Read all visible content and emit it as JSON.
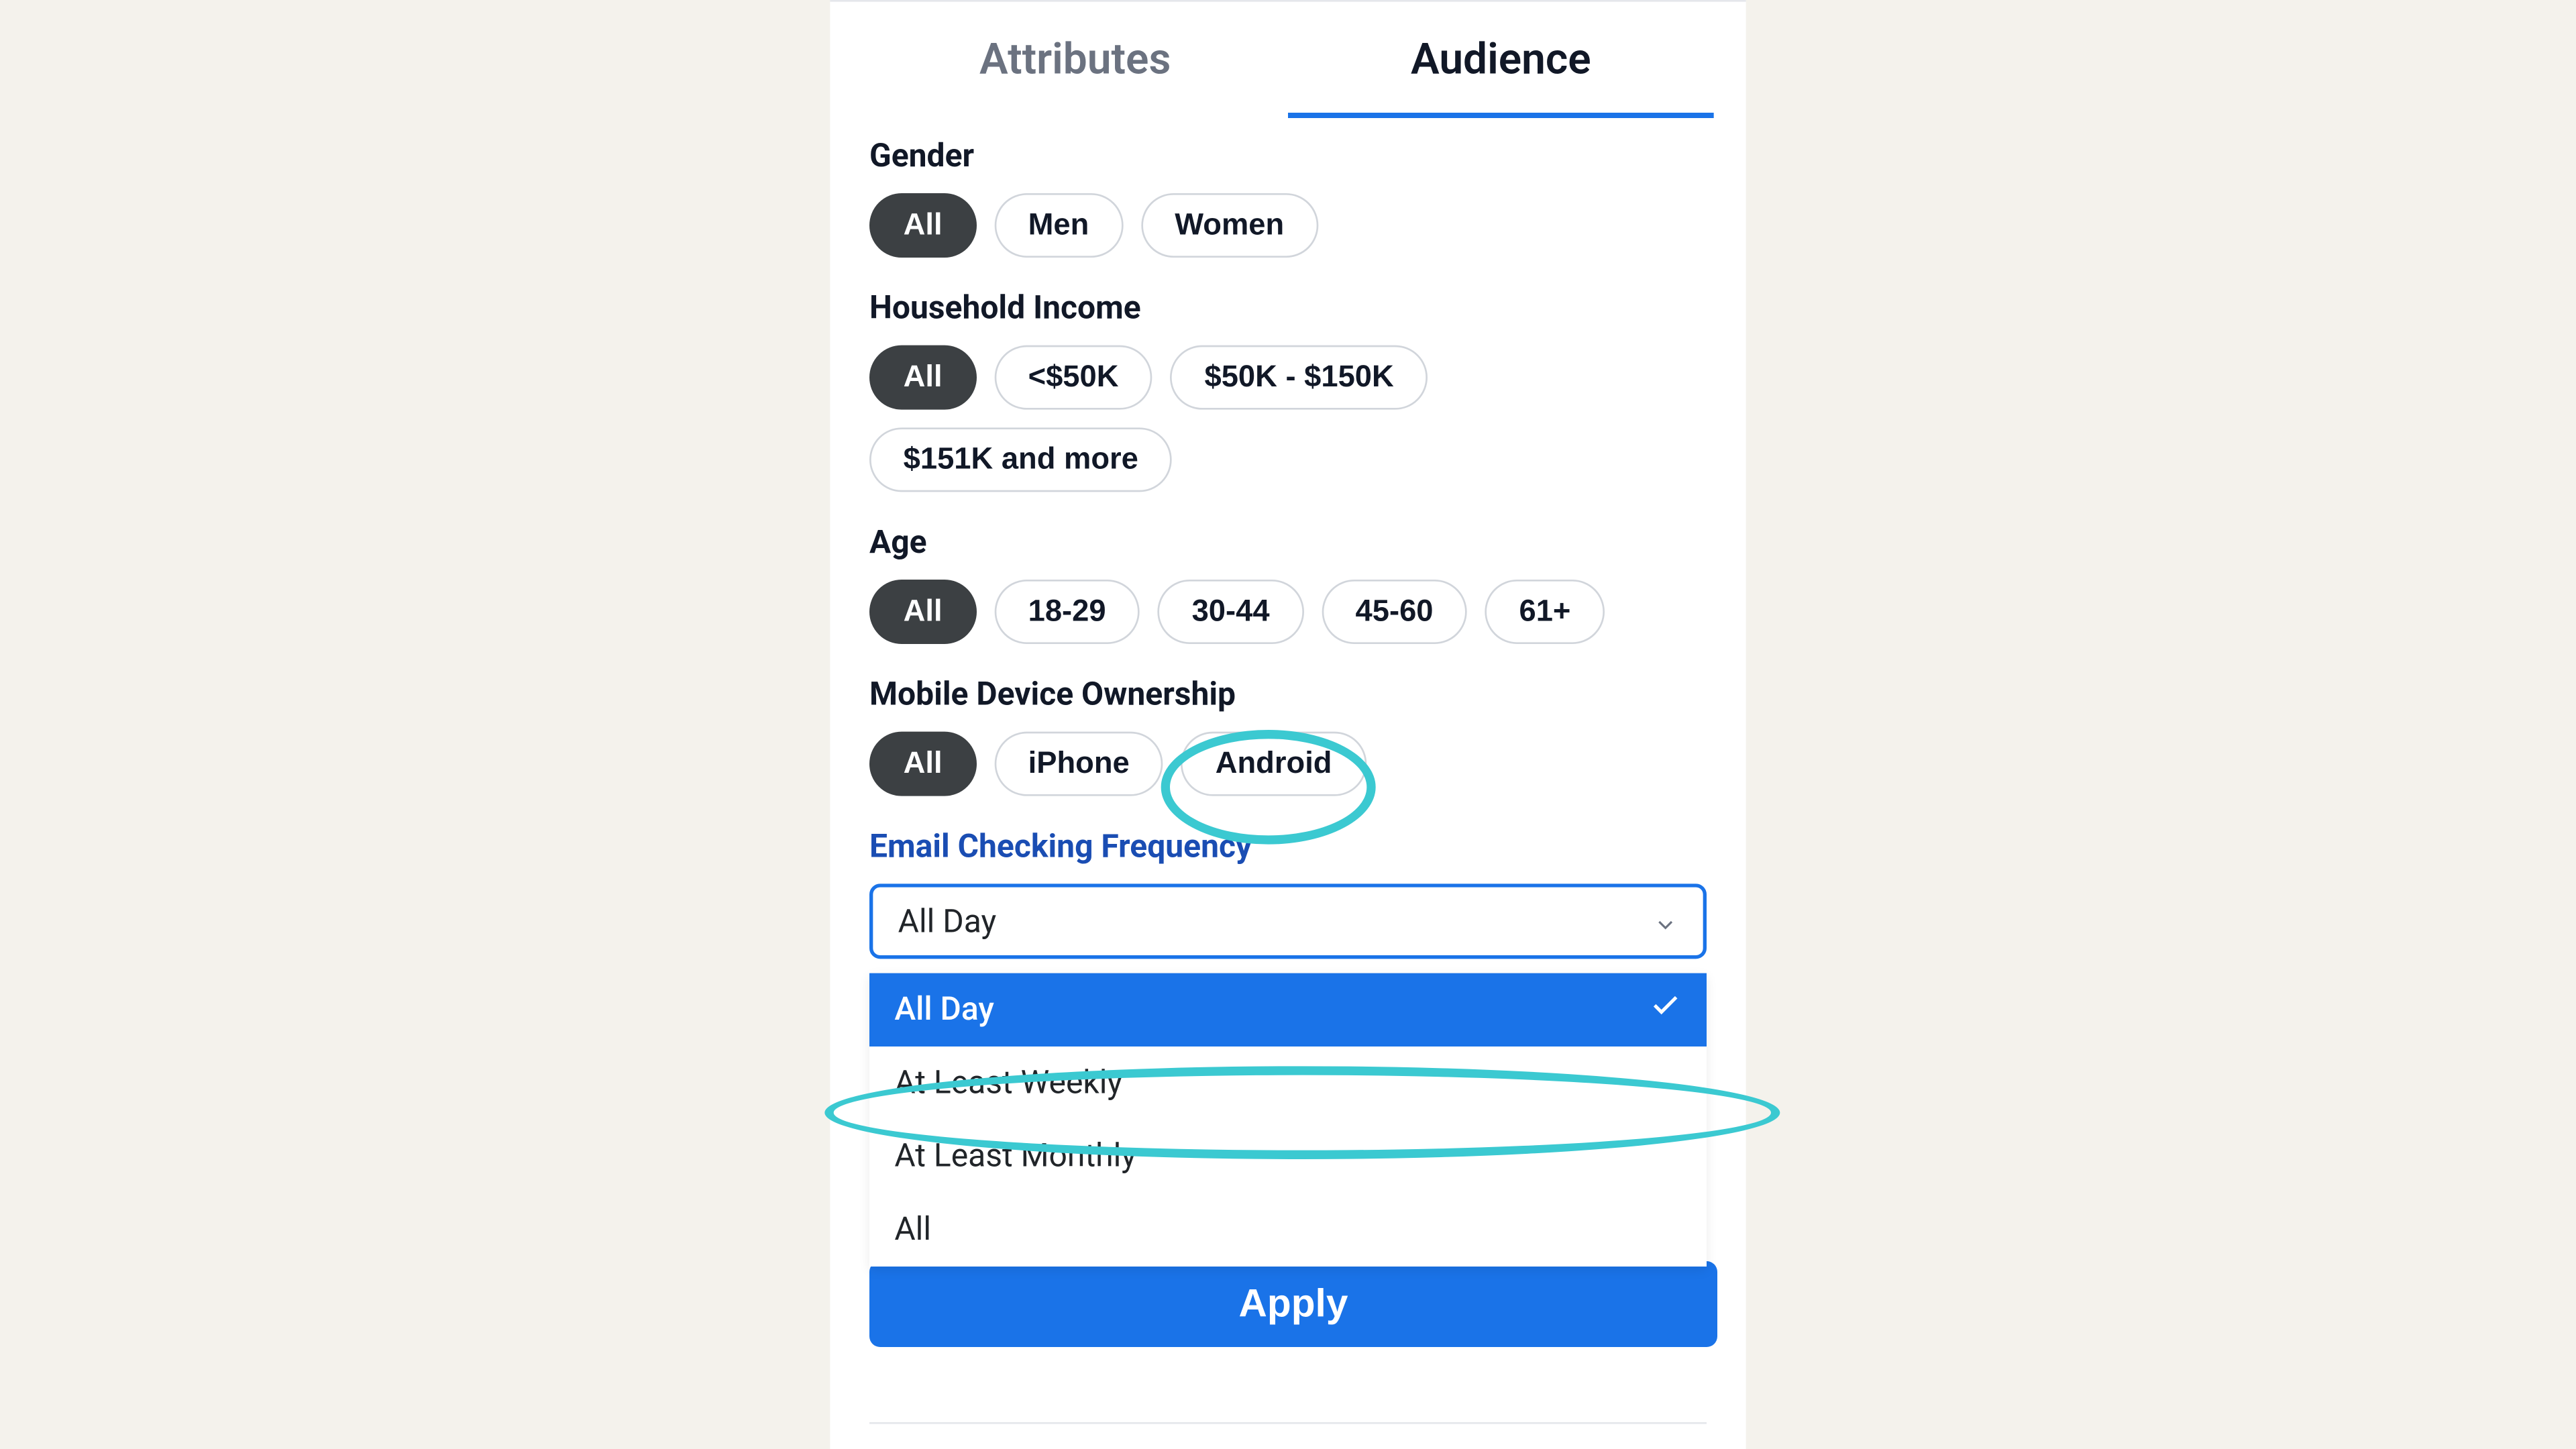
{
  "tabs": {
    "attributes": "Attributes",
    "audience": "Audience",
    "active": "audience"
  },
  "gender": {
    "label": "Gender",
    "options": [
      "All",
      "Men",
      "Women"
    ],
    "selected": 0
  },
  "income": {
    "label": "Household Income",
    "options": [
      "All",
      "<$50K",
      "$50K - $150K",
      "$151K and more"
    ],
    "selected": 0
  },
  "age": {
    "label": "Age",
    "options": [
      "All",
      "18-29",
      "30-44",
      "45-60",
      "61+"
    ],
    "selected": 0
  },
  "device": {
    "label": "Mobile Device Ownership",
    "options": [
      "All",
      "iPhone",
      "Android"
    ],
    "selected": 0
  },
  "email_frequency": {
    "label": "Email Checking Frequency",
    "value": "All Day",
    "options": [
      "All Day",
      "At Least Weekly",
      "At Least Monthly",
      "All"
    ],
    "selected": 0
  },
  "apply_label": "Apply",
  "colors": {
    "accent_blue": "#1a73e8",
    "pill_dark": "#3c4043",
    "annotation": "#3bc9d1",
    "bg": "#f4f2ec"
  }
}
